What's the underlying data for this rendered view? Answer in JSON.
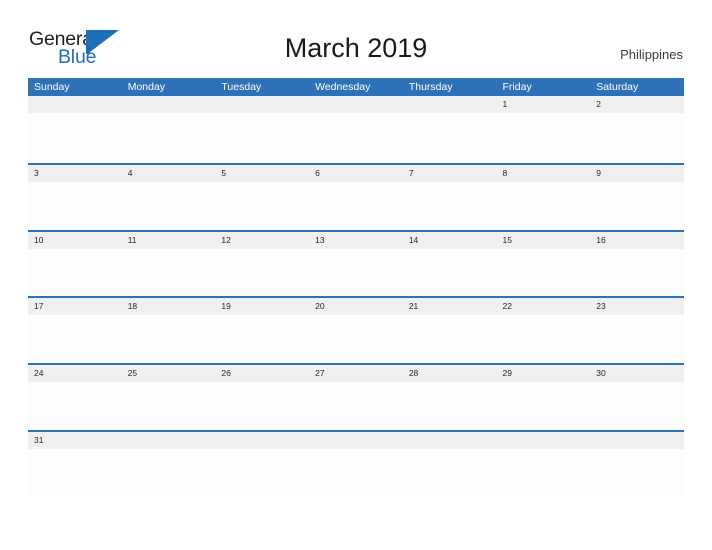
{
  "brand": {
    "name_top": "General",
    "name_bottom": "Blue",
    "accent_color": "#1d6fb8"
  },
  "header": {
    "title": "March 2019",
    "country": "Philippines"
  },
  "colors": {
    "header_blue": "#2d72b8",
    "row_divider_blue": "#2d72b8",
    "daynum_band": "#f0f0f0",
    "page_background": "#ffffff",
    "text_dark": "#262626"
  },
  "calendar": {
    "month": "March",
    "year": "2019",
    "weekday_headers": [
      "Sunday",
      "Monday",
      "Tuesday",
      "Wednesday",
      "Thursday",
      "Friday",
      "Saturday"
    ],
    "weeks": [
      [
        "",
        "",
        "",
        "",
        "",
        "1",
        "2"
      ],
      [
        "3",
        "4",
        "5",
        "6",
        "7",
        "8",
        "9"
      ],
      [
        "10",
        "11",
        "12",
        "13",
        "14",
        "15",
        "16"
      ],
      [
        "17",
        "18",
        "19",
        "20",
        "21",
        "22",
        "23"
      ],
      [
        "24",
        "25",
        "26",
        "27",
        "28",
        "29",
        "30"
      ],
      [
        "31",
        "",
        "",
        "",
        "",
        "",
        ""
      ]
    ]
  }
}
